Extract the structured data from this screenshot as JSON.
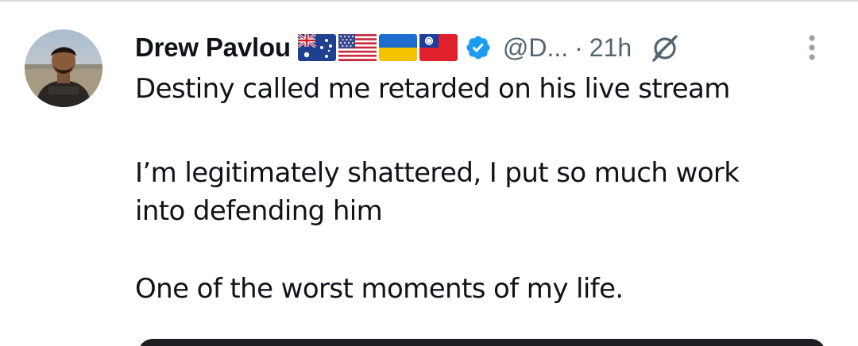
{
  "tweet": {
    "author_name": "Drew Pavlou",
    "flags": [
      {
        "name": "australia-flag"
      },
      {
        "name": "usa-flag"
      },
      {
        "name": "ukraine-flag"
      },
      {
        "name": "taiwan-flag"
      }
    ],
    "verified_icon": "verified-badge-icon",
    "handle": "@D...",
    "separator": "·",
    "time": "21h",
    "action_icon": "grok-icon",
    "more_icon": "more-vertical-icon",
    "paragraphs": [
      [
        "Destiny called me retarded on his live stream"
      ],
      [
        "I’m legitimately shattered, I put so much work",
        "into defending him"
      ],
      [
        "One of the worst moments of my life."
      ]
    ]
  },
  "colors": {
    "text_primary": "#0f1419",
    "text_secondary": "#536471",
    "verified_blue": "#1d9bf0",
    "media_dark": "#1d1f23"
  }
}
